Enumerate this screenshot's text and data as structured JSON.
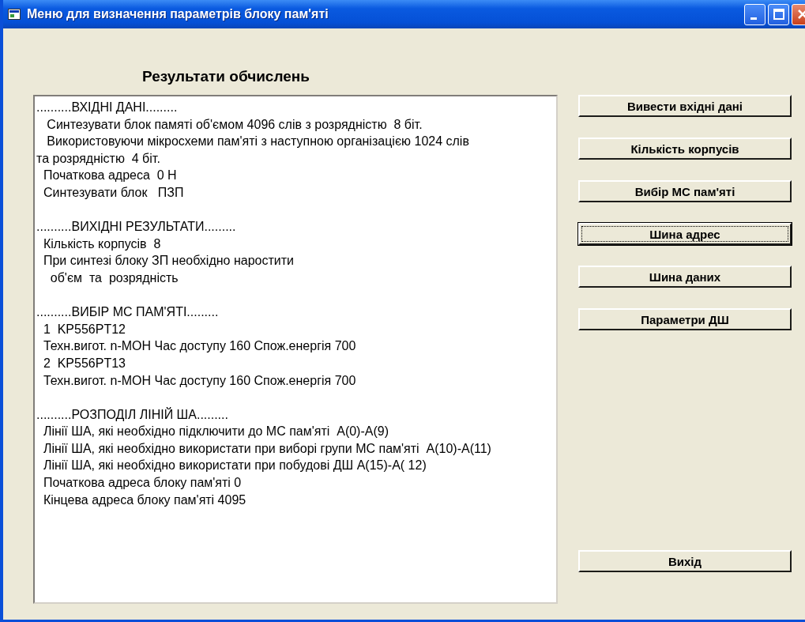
{
  "window": {
    "title": "Меню для визначення параметрів блоку пам'яті"
  },
  "heading": "Результати обчислень",
  "output": [
    {
      "lines": [
        "..........ВХІДНІ ДАНІ.........",
        "   Синтезувати блок памяті об'ємом 4096 слів з розрядністю  8 біт.",
        "   Використовуючи мікросхеми пам'яті з наступною організацією 1024 слів",
        "та розрядністю  4 біт.",
        "  Початкова адреса  0 H",
        "  Синтезувати блок   ПЗП"
      ]
    },
    {
      "lines": [
        "..........ВИХІДНІ РЕЗУЛЬТАТИ.........",
        "  Кількість корпусів  8",
        "  При синтезі блоку ЗП необхідно наростити",
        "    об'єм  та  розрядність"
      ]
    },
    {
      "lines": [
        "..........ВИБІР МС ПАМ'ЯТІ.........",
        "  1  KP556PT12",
        "  Техн.вигот. n-МОН Час доступу 160 Спож.енергія 700",
        "  2  KP556PT13",
        "  Техн.вигот. n-МОН Час доступу 160 Спож.енергія 700"
      ]
    },
    {
      "lines": [
        "..........РОЗПОДІЛ ЛІНІЙ ША.........",
        "  Лінії ША, які необхідно підключити до МС пам'яті  A(0)-A(9)",
        "  Лінії ША, які необхідно використати при виборі групи МС пам'яті  A(10)-A(11)",
        "  Лінії ША, які необхідно використати при побудові ДШ A(15)-A( 12)",
        "  Початкова адреса блоку пам'яті 0",
        "  Кінцева адреса блоку пам'яті 4095"
      ]
    }
  ],
  "buttons": [
    {
      "label": "Вивести вхідні дані",
      "focused": false
    },
    {
      "label": "Кількість корпусів",
      "focused": false
    },
    {
      "label": "Вибір МС пам'яті",
      "focused": false
    },
    {
      "label": "Шина адрес",
      "focused": true
    },
    {
      "label": "Шина даних",
      "focused": false
    },
    {
      "label": "Параметри ДШ",
      "focused": false
    }
  ],
  "exit_button": {
    "label": "Вихід",
    "focused": false
  }
}
